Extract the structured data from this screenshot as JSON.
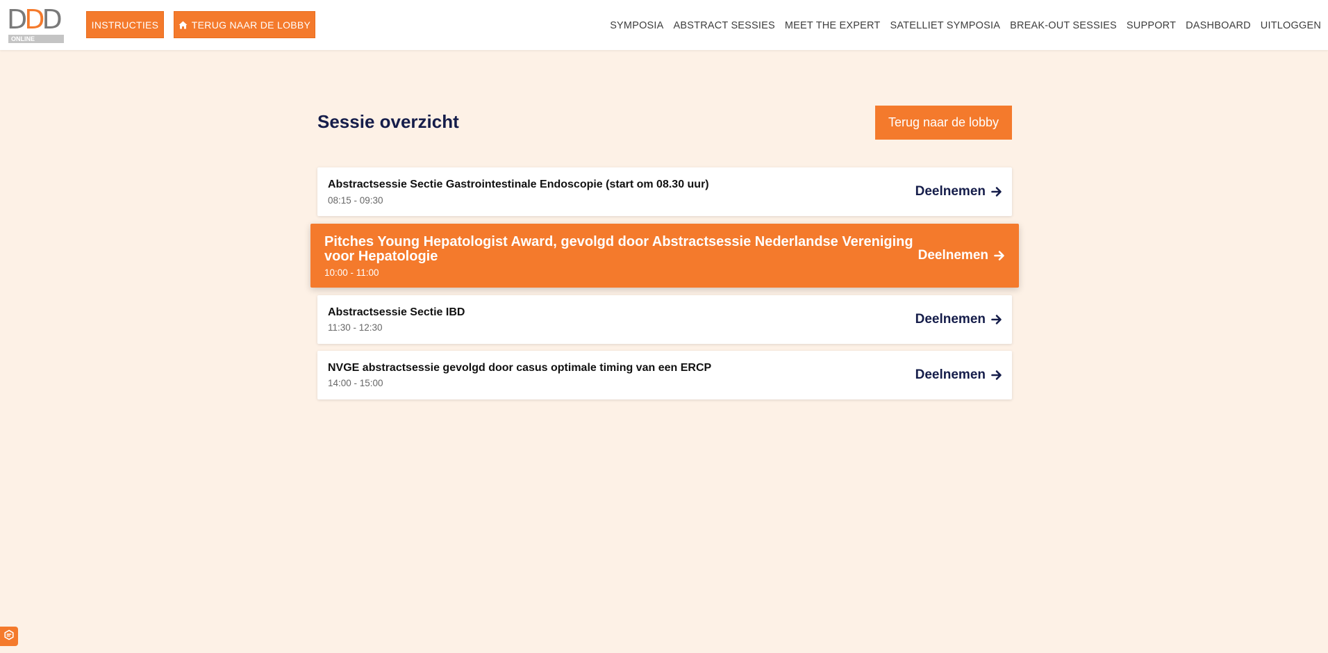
{
  "logo": {
    "letters": [
      "D",
      "D",
      "D"
    ],
    "subtitle": "ONLINE"
  },
  "topbar": {
    "instructies_label": "INSTRUCTIES",
    "lobby_label": "TERUG NAAR DE LOBBY",
    "lobby_icon": "home-icon"
  },
  "nav": {
    "items": [
      "SYMPOSIA",
      "ABSTRACT SESSIES",
      "MEET THE EXPERT",
      "SATELLIET SYMPOSIA",
      "BREAK-OUT SESSIES",
      "SUPPORT",
      "DASHBOARD",
      "UITLOGGEN"
    ]
  },
  "main": {
    "title": "Sessie overzicht",
    "back_label": "Terug naar de lobby",
    "join_label": "Deelnemen",
    "sessions": [
      {
        "title": "Abstractsessie Sectie Gastrointestinale Endoscopie (start om 08.30 uur)",
        "time": "08:15 - 09:30"
      },
      {
        "title": "Pitches Young Hepatologist Award, gevolgd door Abstractsessie Nederlandse Vereniging voor Hepatologie",
        "time": "10:00 - 11:00"
      },
      {
        "title": "Abstractsessie Sectie IBD",
        "time": "11:30 - 12:30"
      },
      {
        "title": "NVGE abstractsessie gevolgd door casus optimale timing van een ERCP",
        "time": "14:00 - 15:00"
      }
    ]
  },
  "colors": {
    "accent": "#f47a2c",
    "navy": "#151d4a",
    "background": "#fdf1e6"
  }
}
